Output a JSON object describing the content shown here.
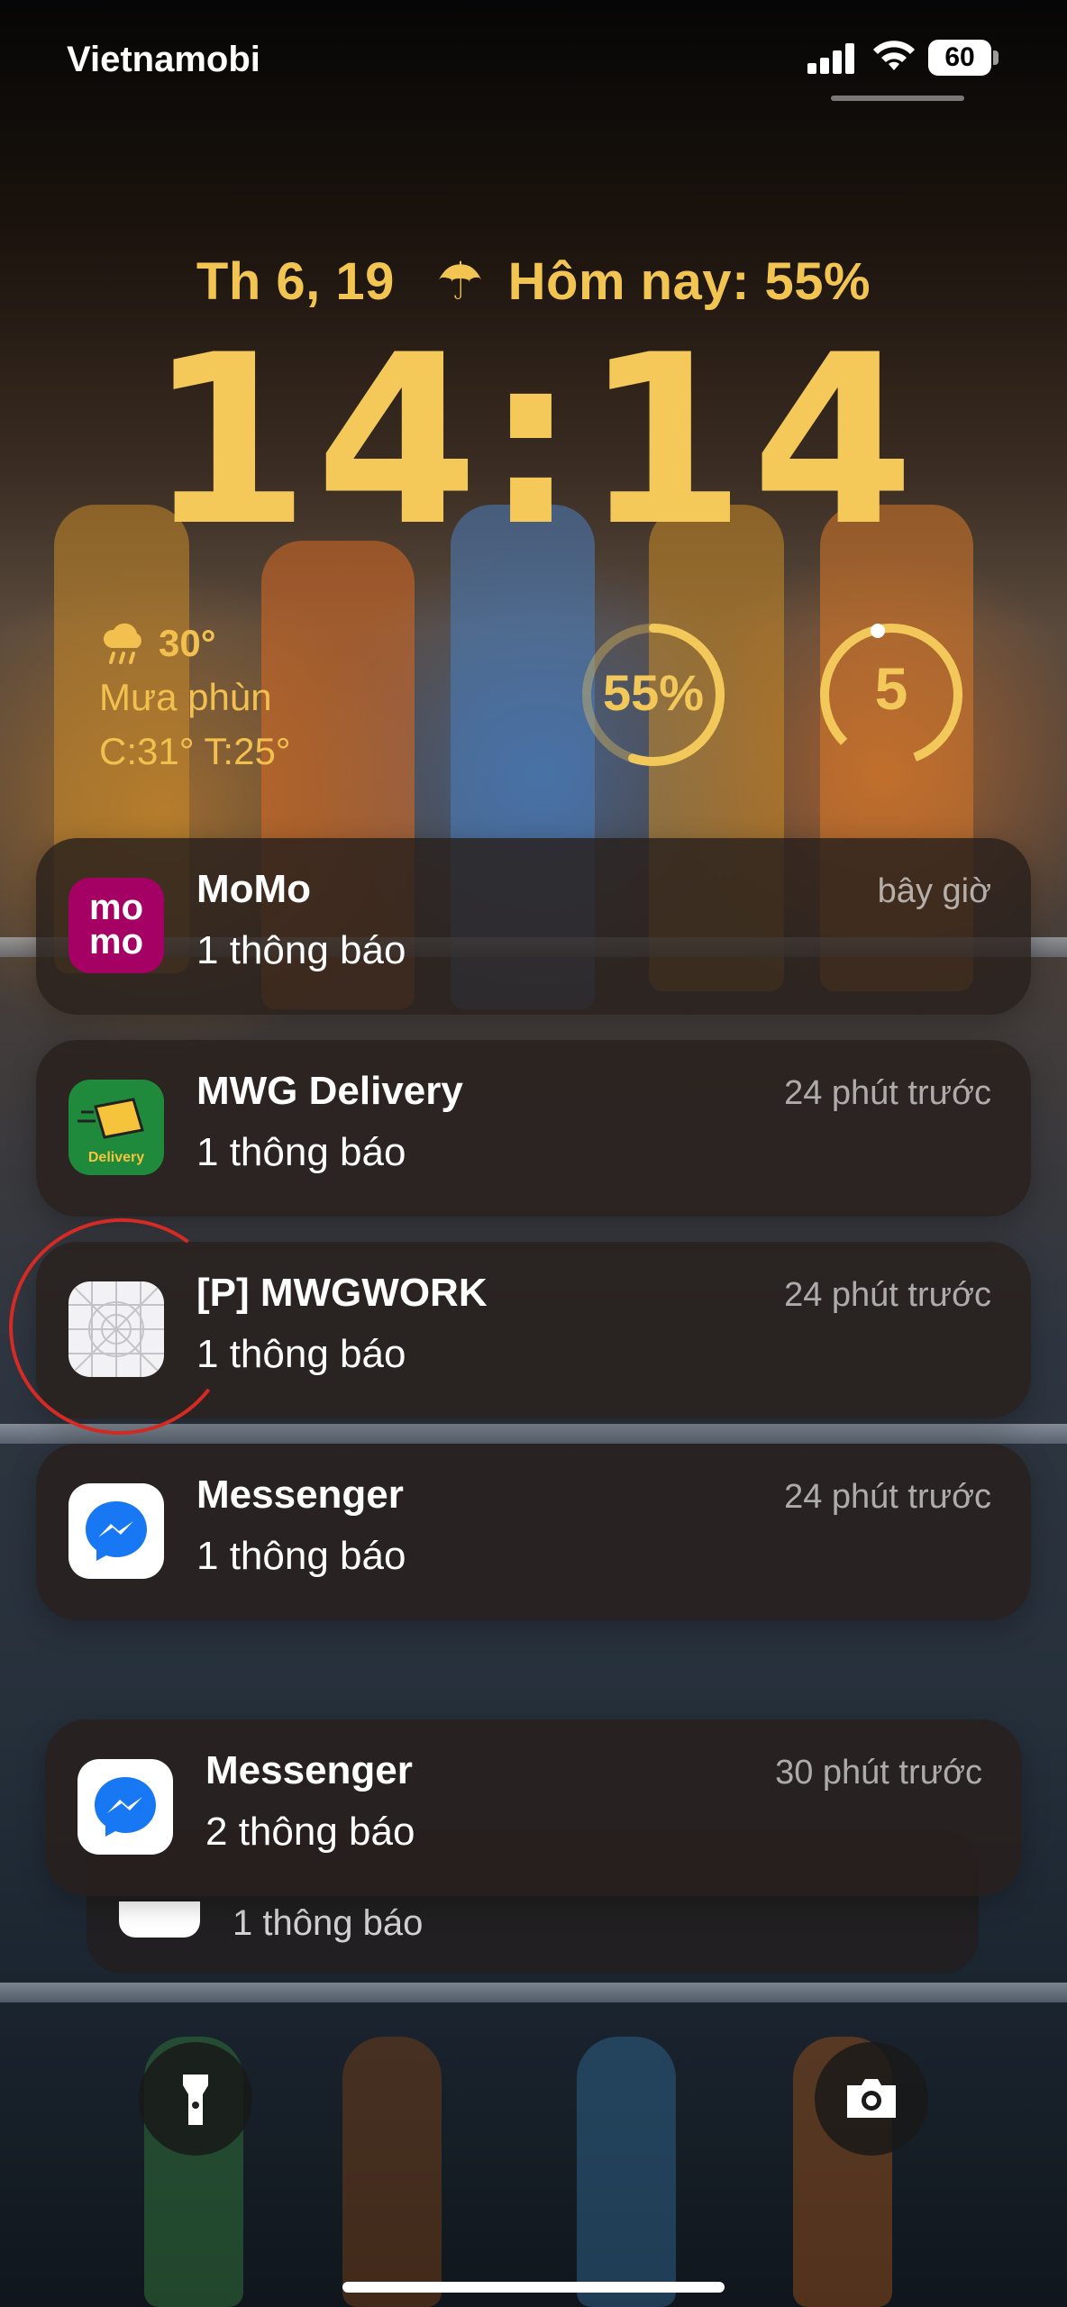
{
  "status_bar": {
    "carrier": "Vietnamobi",
    "battery": "60"
  },
  "lock_screen": {
    "date": "Th 6, 19",
    "forecast": "Hôm nay: 55%",
    "time": "14:14",
    "accent_color": "#f4c95a"
  },
  "widgets": {
    "weather": {
      "temp": "30°",
      "condition": "Mưa phùn",
      "range": "C:31° T:25°"
    },
    "ring_left": {
      "label": "55%",
      "level": 0.55
    },
    "ring_right": {
      "label": "5"
    }
  },
  "notifications": [
    {
      "app": "MoMo",
      "body": "1 thông báo",
      "time": "bây giờ",
      "icon": "momo-icon"
    },
    {
      "app": "MWG Delivery",
      "body": "1 thông báo",
      "time": "24 phút trước",
      "icon": "mwg-delivery-icon"
    },
    {
      "app": "[P] MWGWORK",
      "body": "1 thông báo",
      "time": "24 phút trước",
      "icon": "placeholder-app-icon"
    },
    {
      "app": "Messenger",
      "body": "1 thông báo",
      "time": "24 phút trước",
      "icon": "messenger-icon"
    },
    {
      "app": "Messenger",
      "body": "2 thông báo",
      "time": "30 phút trước",
      "icon": "messenger-icon"
    }
  ],
  "stacked_notification": {
    "body": "1 thông báo"
  },
  "controls": {
    "flashlight": "flashlight-icon",
    "camera": "camera-icon"
  },
  "icon_labels": {
    "momo_top": "mo",
    "momo_bottom": "mo",
    "delivery": "Delivery"
  }
}
